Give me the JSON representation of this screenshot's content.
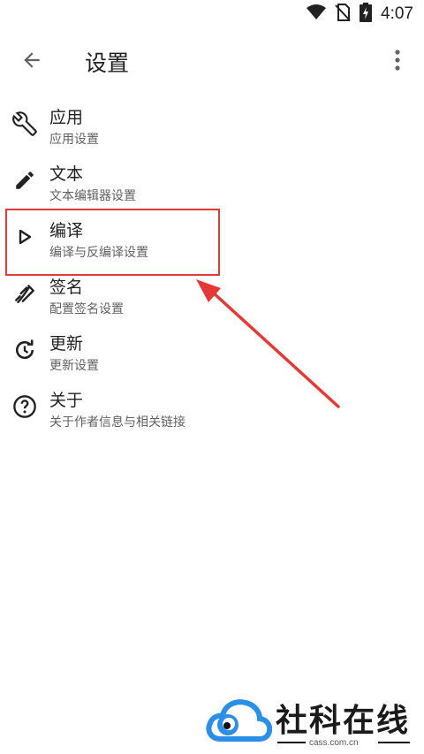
{
  "status": {
    "time": "4:07",
    "icons": [
      "wifi-icon",
      "no-sim-icon",
      "battery-charging-icon"
    ]
  },
  "app_bar": {
    "title": "设置",
    "back_icon": "arrow-back-icon",
    "more_icon": "more-vert-icon"
  },
  "items": [
    {
      "title": "应用",
      "subtitle": "应用设置",
      "icon": "wrench-icon"
    },
    {
      "title": "文本",
      "subtitle": "文本编辑器设置",
      "icon": "pencil-icon"
    },
    {
      "title": "编译",
      "subtitle": "编译与反编译设置",
      "icon": "play-outline-icon"
    },
    {
      "title": "签名",
      "subtitle": "配置签名设置",
      "icon": "signature-icon"
    },
    {
      "title": "更新",
      "subtitle": "更新设置",
      "icon": "update-icon"
    },
    {
      "title": "关于",
      "subtitle": "关于作者信息与相关链接",
      "icon": "help-circle-icon"
    }
  ],
  "colors": {
    "annotation": "#e53935",
    "watermark_blue": "#2b8fe8"
  },
  "watermark": {
    "text": "社科在线",
    "domain": "cass.com.cn"
  }
}
